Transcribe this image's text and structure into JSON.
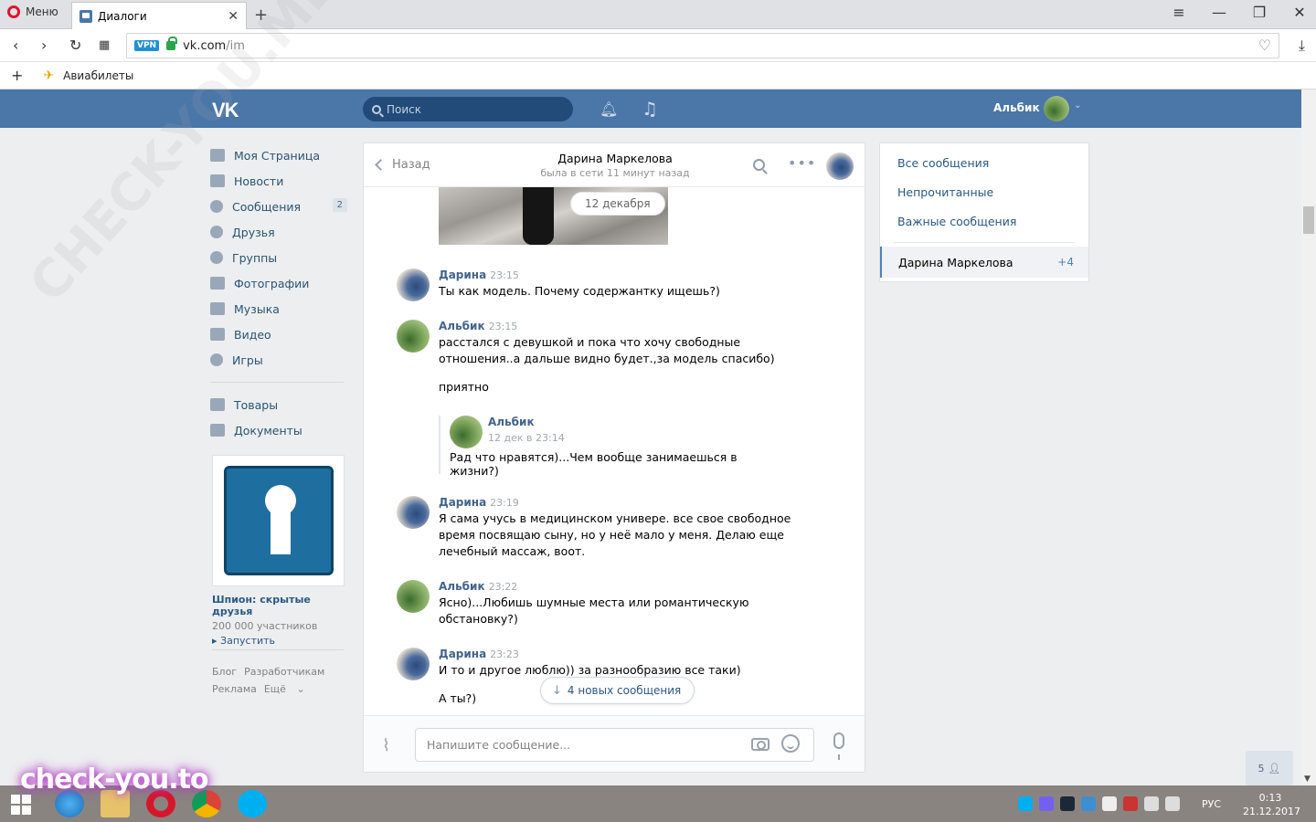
{
  "browser": {
    "menu_label": "Меню",
    "tab_title": "Диалоги",
    "url_host": "vk.com",
    "url_path": "/im",
    "vpn_label": "VPN",
    "bookmark": "Авиабилеты"
  },
  "header": {
    "logo": "VK",
    "search_placeholder": "Поиск",
    "user_name": "Альбик"
  },
  "left_menu": {
    "items": [
      {
        "label": "Моя Страница"
      },
      {
        "label": "Новости"
      },
      {
        "label": "Сообщения",
        "count": "2"
      },
      {
        "label": "Друзья"
      },
      {
        "label": "Группы"
      },
      {
        "label": "Фотографии"
      },
      {
        "label": "Музыка"
      },
      {
        "label": "Видео"
      },
      {
        "label": "Игры"
      }
    ],
    "extra_items": [
      {
        "label": "Товары"
      },
      {
        "label": "Документы"
      }
    ],
    "ad": {
      "title": "Шпион: скрытые друзья",
      "members": "200 000 участников",
      "launch": "Запустить"
    },
    "footer": {
      "blog": "Блог",
      "developers": "Разработчикам",
      "ads": "Реклама",
      "more": "Ещё"
    }
  },
  "chat": {
    "back_label": "Назад",
    "peer_name": "Дарина Маркелова",
    "peer_status": "была в сети 11 минут назад",
    "date_divider": "12 декабря",
    "messages": [
      {
        "author": "Дарина",
        "time": "23:15",
        "lines": [
          "Ты как модель. Почему содержантку ищешь?)"
        ]
      },
      {
        "author": "Альбик",
        "time": "23:15",
        "lines": [
          "расстался с девушкой и пока что хочу свободные",
          "отношения..а дальше видно будет.,за модель спасибо)"
        ],
        "extra": "приятно"
      },
      {
        "author": "Дарина",
        "time": "23:19",
        "lines": [
          "Я сама учусь в медицинском универе. все свое свободное",
          "время посвящаю сыну, но у неё мало у меня. Делаю еще",
          "лечебный массаж, воот."
        ]
      },
      {
        "author": "Альбик",
        "time": "23:22",
        "lines": [
          "Ясно)...Любишь шумные места или романтическую",
          "обстановку?)"
        ]
      },
      {
        "author": "Дарина",
        "time": "23:23",
        "lines": [
          "И то и другое люблю)) за разнообразию все таки)"
        ],
        "extra": "А ты?)"
      }
    ],
    "forwarded": {
      "author": "Альбик",
      "date": "12 дек в 23:14",
      "text": "Рад что нравятся)...Чем вообще занимаешься в жизни?)"
    },
    "new_messages_label": "4 новых сообщения",
    "composer_placeholder": "Напишите сообщение..."
  },
  "filters": {
    "all": "Все сообщения",
    "unread": "Непрочитанные",
    "important": "Важные сообщения",
    "active_dialog": "Дарина Маркелова",
    "active_count": "+4"
  },
  "online_count": "5",
  "taskbar": {
    "lang": "РУС",
    "time": "0:13",
    "date": "21.12.2017"
  },
  "watermark": "check-you.to",
  "watermark_diag": "CHECK-YOU.ME",
  "colors": {
    "vk_blue": "#4a76a8",
    "link": "#2a5885",
    "bg": "#edeef0"
  }
}
